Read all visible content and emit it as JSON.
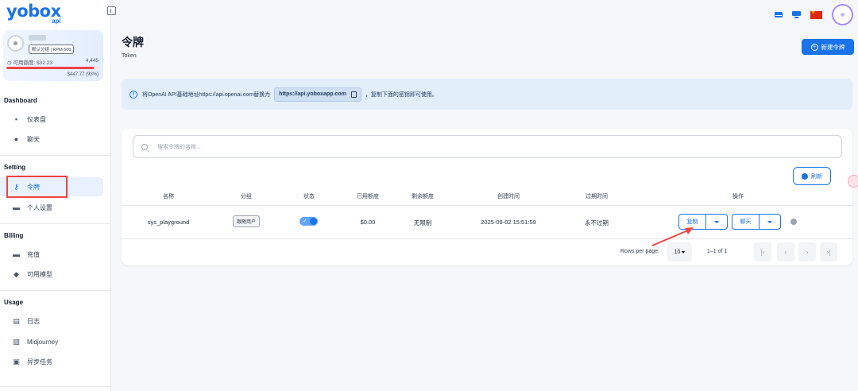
{
  "brand": {
    "name": "yobox",
    "sub": "api"
  },
  "user_card": {
    "tag": "默认分组 | RPM 600",
    "quota_label": "可用额度: $32.23",
    "quota_count": "4,445",
    "quota_total": "$447.77 (93%)",
    "progress_fraction": 0.93
  },
  "nav": {
    "sections": [
      {
        "title": "Dashboard",
        "items": [
          {
            "label": "仪表盘",
            "icon": "dashboard-icon"
          },
          {
            "label": "聊天",
            "icon": "chat-icon"
          }
        ]
      },
      {
        "title": "Setting",
        "items": [
          {
            "label": "令牌",
            "icon": "key-icon",
            "active": true
          },
          {
            "label": "个人设置",
            "icon": "profile-icon"
          }
        ]
      },
      {
        "title": "Billing",
        "items": [
          {
            "label": "充值",
            "icon": "wallet-icon"
          },
          {
            "label": "可用模型",
            "icon": "cube-icon"
          }
        ]
      },
      {
        "title": "Usage",
        "items": [
          {
            "label": "日志",
            "icon": "log-icon"
          },
          {
            "label": "Midjourney",
            "icon": "image-icon"
          },
          {
            "label": "异步任务",
            "icon": "task-icon"
          }
        ]
      }
    ]
  },
  "header": {
    "title": "令牌",
    "subtitle": "Token",
    "new_button": "新建令牌"
  },
  "notice": {
    "text_before": "将OpenAI API基础地址https://api.openai.com替换为",
    "url": "https://api.yoboxapp.com",
    "text_after": "，复制下面的密钥即可使用。"
  },
  "search": {
    "placeholder": "搜索令牌的名称..."
  },
  "refresh_label": "刷新",
  "table": {
    "columns": [
      "名称",
      "分组",
      "状态",
      "已用额度",
      "剩余额度",
      "创建时间",
      "过期时间",
      "操作"
    ],
    "rows": [
      {
        "name": "sys_playground",
        "group": "跟随用户",
        "enabled": true,
        "used": "$0.00",
        "remaining": "无限制",
        "created": "2025-09-02 15:51:59",
        "expires": "永不过期",
        "copy_label": "复制",
        "chat_label": "聊天"
      }
    ]
  },
  "pagination": {
    "rows_per_page_label": "Rows per page:",
    "rows_per_page": "10",
    "range": "1–1 of 1"
  },
  "colors": {
    "accent": "#1a73e8",
    "danger": "#ef4444",
    "notice_bg": "#e3eefb"
  }
}
